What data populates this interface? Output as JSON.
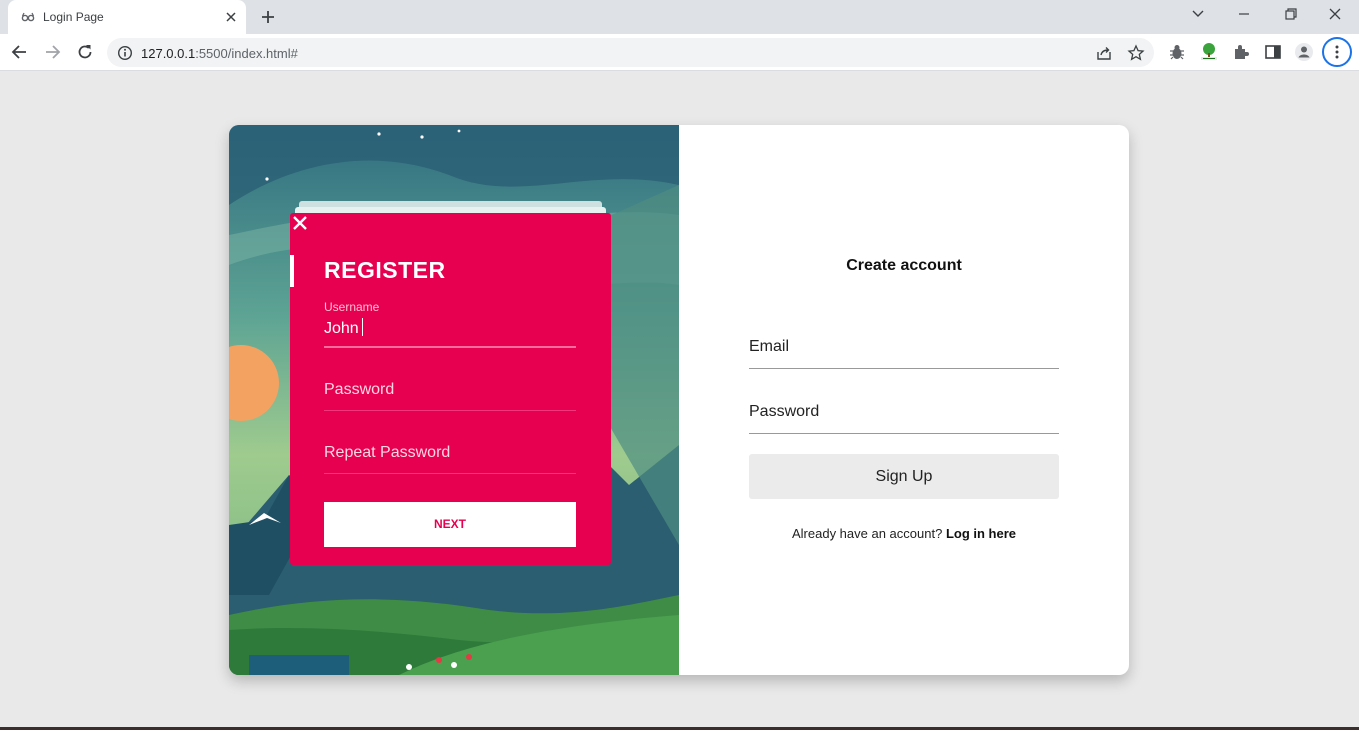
{
  "browser": {
    "tab_title": "Login Page",
    "url_host": "127.0.0.1",
    "url_path": ":5500/index.html#",
    "icons": {
      "favicon": "glasses-icon",
      "tab_close": "close-icon",
      "new_tab": "plus-icon",
      "back": "arrow-left-icon",
      "forward": "arrow-right-icon",
      "reload": "reload-icon",
      "site_info": "info-icon",
      "share": "share-icon",
      "bookmark": "star-icon",
      "extensions": [
        "bug-icon",
        "tree-icon",
        "puzzle-icon",
        "side-panel-icon",
        "profile-icon"
      ],
      "menu": "kebab-menu-icon",
      "window_controls": [
        "chevron-down-icon",
        "minimize-icon",
        "restore-icon",
        "close-icon"
      ]
    }
  },
  "illustration": {
    "panel_title": "REGISTER",
    "username_label": "Username",
    "username_value": "John",
    "password_placeholder": "Password",
    "repeat_password_placeholder": "Repeat Password",
    "next_label": "NEXT",
    "accent_color": "#e6004f"
  },
  "form": {
    "title": "Create account",
    "email_label": "Email",
    "password_label": "Password",
    "submit_label": "Sign Up",
    "login_prompt": "Already have an account?",
    "login_link": "Log in here"
  }
}
